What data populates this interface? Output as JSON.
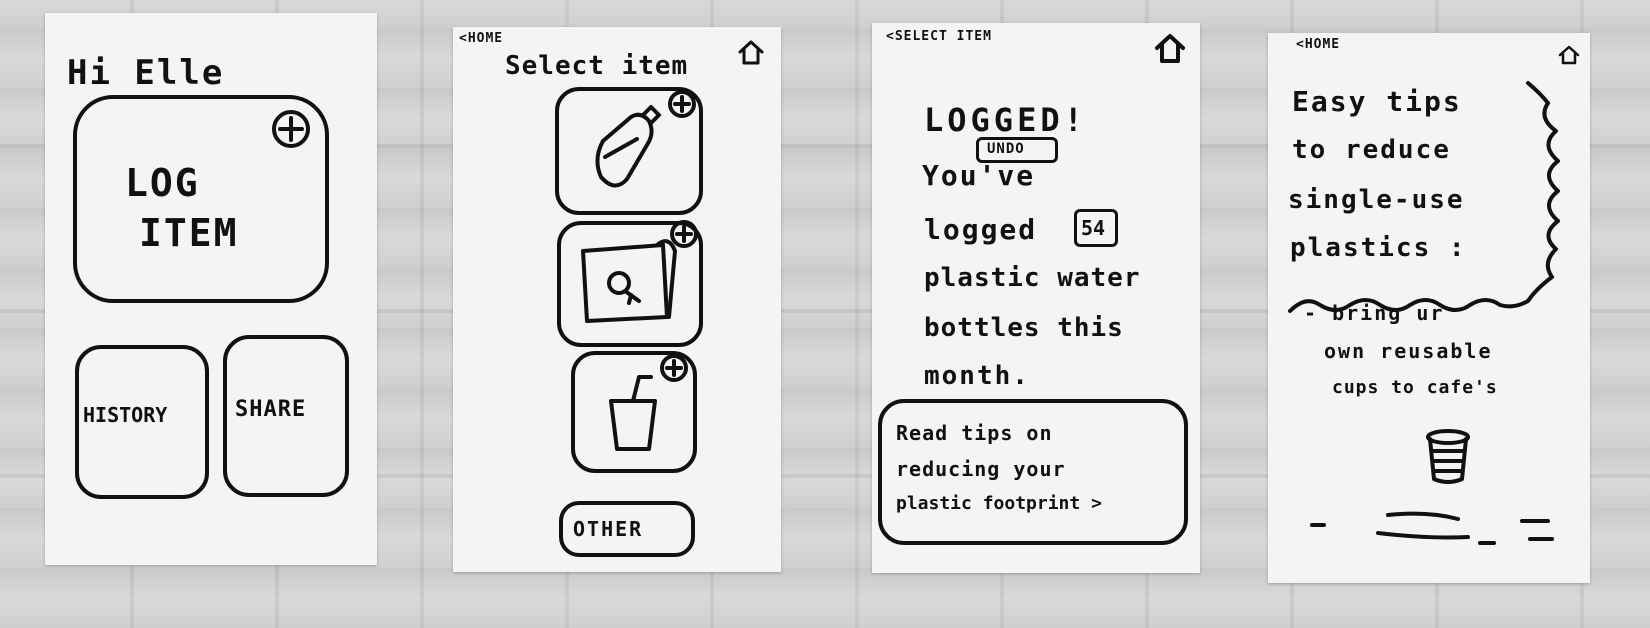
{
  "screens": [
    {
      "greeting": "Hi Elle",
      "log_button": {
        "line1": "LOG",
        "line2": "ITEM",
        "icon": "plus-icon"
      },
      "history_button": "HISTORY",
      "share_button": "SHARE"
    },
    {
      "back_link": "<HOME",
      "title": "Select item",
      "home_icon": "home-icon",
      "items": [
        {
          "icon": "water-bottle-icon"
        },
        {
          "icon": "plastic-bag-icon"
        },
        {
          "icon": "cup-with-straw-icon"
        }
      ],
      "other_button": "OTHER"
    },
    {
      "back_link": "<SELECT ITEM",
      "home_icon": "home-icon",
      "logged_title": "LOGGED!",
      "undo_button": "UNDO",
      "message_line1": "You've",
      "message_line2a": "logged",
      "logged_count": "54",
      "message_line3": "plastic water",
      "message_line4": "bottles this",
      "message_line5": "month.",
      "tips_link_line1": "Read tips on",
      "tips_link_line2": "reducing your",
      "tips_link_line3": "plastic footprint >"
    },
    {
      "back_link": "<HOME",
      "home_icon": "home-icon",
      "tips_title_lines": [
        "Easy tips",
        "to reduce",
        "single-use",
        "plastics :"
      ],
      "tip_lines": [
        "- bring ur",
        "own reusable",
        "cups to cafe's"
      ],
      "cup_icon": "reusable-cup-icon"
    }
  ]
}
